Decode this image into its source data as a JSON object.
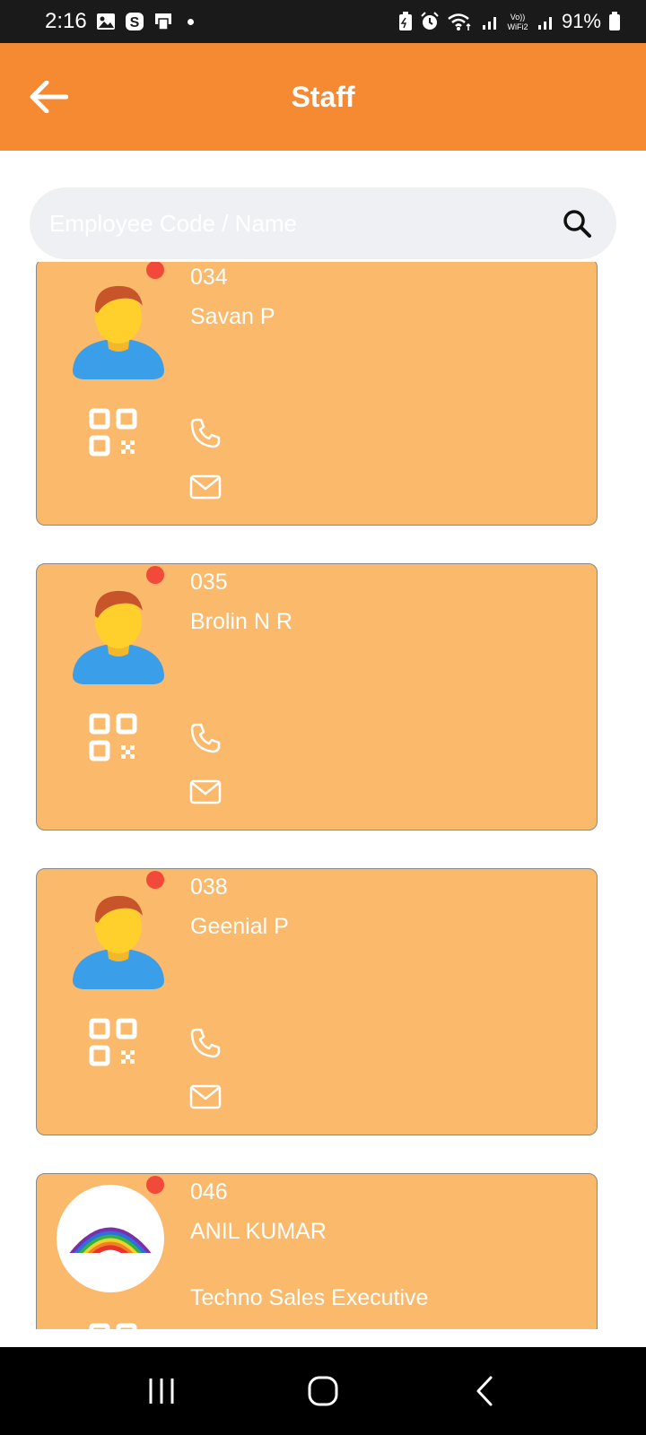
{
  "status_bar": {
    "time": "2:16",
    "battery": "91%",
    "icons": [
      "gallery-icon",
      "skype-icon",
      "device-icon",
      "notification-dot",
      "battery-saver-icon",
      "alarm-icon",
      "wifi-icon",
      "signal-icon",
      "volte-wifi2-icon",
      "signal-icon",
      "battery-icon"
    ]
  },
  "app_bar": {
    "title": "Staff",
    "back_icon": "arrow-left-icon",
    "background": "#f68a33"
  },
  "search": {
    "placeholder": "Employee Code / Name",
    "value": "",
    "icon": "search-icon"
  },
  "staff": [
    {
      "code": "034",
      "name": "Savan P",
      "role": "",
      "avatar": "cartoon-man-avatar",
      "status_color": "#f24a3a"
    },
    {
      "code": "035",
      "name": "Brolin N R",
      "role": "",
      "avatar": "cartoon-man-avatar",
      "status_color": "#f24a3a"
    },
    {
      "code": "038",
      "name": "Geenial P",
      "role": "",
      "avatar": "cartoon-man-avatar",
      "status_color": "#f24a3a"
    },
    {
      "code": "046",
      "name": "ANIL KUMAR",
      "role": "Techno Sales Executive",
      "avatar": "rainbow-logo-photo",
      "status_color": "#f24a3a"
    }
  ],
  "card_colors": {
    "background": "#fab96b",
    "border": "#8a8a8a"
  },
  "nav_bar": {
    "buttons": [
      "recents-icon",
      "home-icon",
      "back-icon"
    ]
  }
}
